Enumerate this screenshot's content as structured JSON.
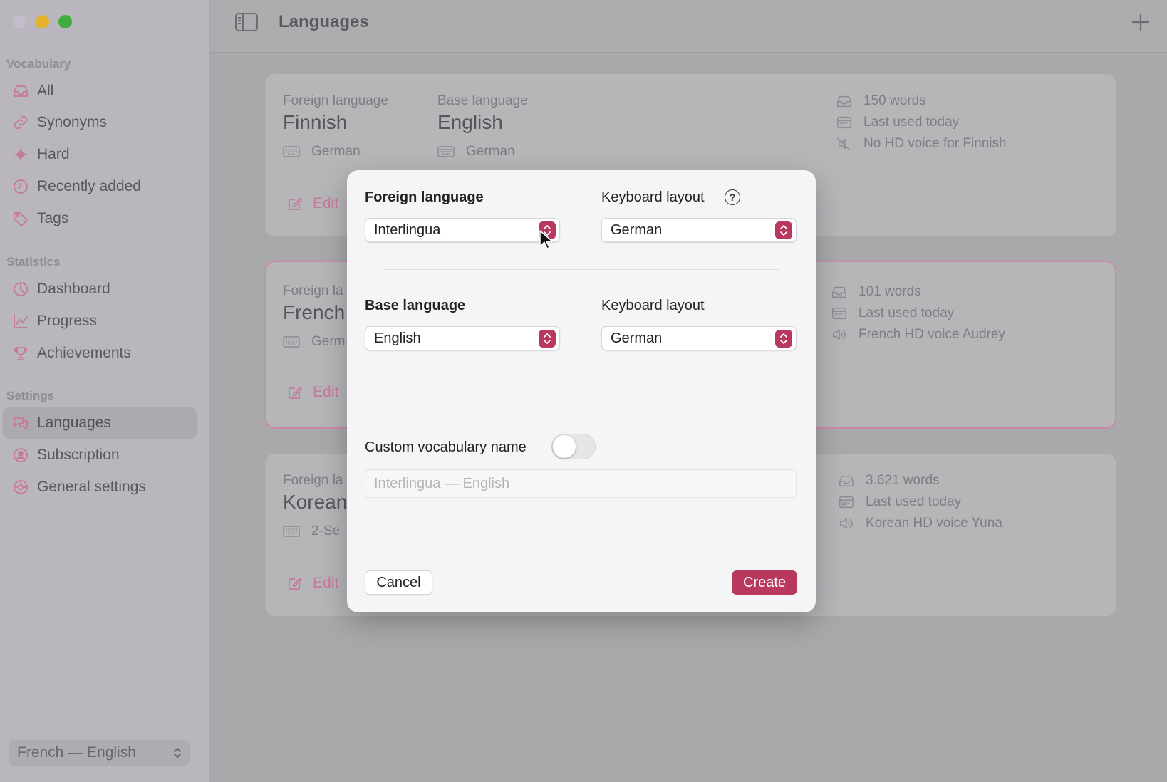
{
  "sidebar": {
    "sections": [
      {
        "title": "Vocabulary",
        "items": [
          {
            "label": "All",
            "icon": "tray-icon"
          },
          {
            "label": "Synonyms",
            "icon": "link-icon"
          },
          {
            "label": "Hard",
            "icon": "sparkle-icon"
          },
          {
            "label": "Recently added",
            "icon": "clock-icon"
          },
          {
            "label": "Tags",
            "icon": "tag-icon"
          }
        ]
      },
      {
        "title": "Statistics",
        "items": [
          {
            "label": "Dashboard",
            "icon": "chart-pie-icon"
          },
          {
            "label": "Progress",
            "icon": "line-chart-icon"
          },
          {
            "label": "Achievements",
            "icon": "trophy-icon"
          }
        ]
      },
      {
        "title": "Settings",
        "items": [
          {
            "label": "Languages",
            "icon": "speech-bubbles-icon",
            "active": true
          },
          {
            "label": "Subscription",
            "icon": "person-circle-icon"
          },
          {
            "label": "General settings",
            "icon": "gear-icon"
          }
        ]
      }
    ],
    "vocab_select": "French — English"
  },
  "header": {
    "title": "Languages"
  },
  "cards": [
    {
      "foreign_label": "Foreign language",
      "foreign": "Finnish",
      "foreign_kb": "German",
      "base_label": "Base language",
      "base": "English",
      "base_kb": "German",
      "edit": "Edit",
      "words": "150 words",
      "last_used": "Last used today",
      "voice": "No HD voice for Finnish"
    },
    {
      "foreign_label": "Foreign la",
      "foreign": "French",
      "foreign_kb": "Germ",
      "edit": "Edit",
      "words": "101 words",
      "last_used": "Last used today",
      "voice": "French HD voice Audrey"
    },
    {
      "foreign_label": "Foreign la",
      "foreign": "Korean",
      "foreign_kb": "2-Se",
      "edit": "Edit",
      "words": "3.621 words",
      "last_used": "Last used today",
      "voice": "Korean HD voice Yuna"
    }
  ],
  "dialog": {
    "foreign_label": "Foreign language",
    "foreign_value": "Interlingua",
    "kb1_label": "Keyboard layout",
    "kb1_value": "German",
    "help": "?",
    "base_label": "Base language",
    "base_value": "English",
    "kb2_label": "Keyboard layout",
    "kb2_value": "German",
    "custom_label": "Custom vocabulary name",
    "custom_enabled": false,
    "name_placeholder": "Interlingua — English",
    "cancel": "Cancel",
    "create": "Create"
  },
  "colors": {
    "accent": "#b8385e",
    "icon_pink": "#c57a99"
  }
}
